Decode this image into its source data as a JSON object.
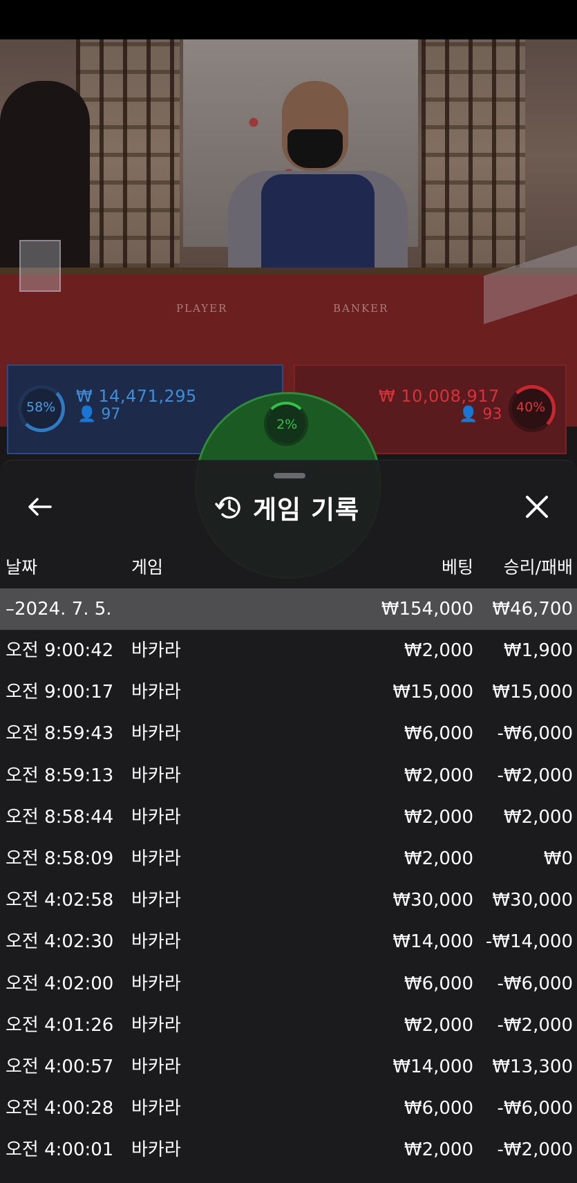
{
  "bet_panel": {
    "player": {
      "percent": "58%",
      "amount": "₩ 14,471,295",
      "players": "97",
      "pct_value": 0.58
    },
    "banker": {
      "percent": "40%",
      "amount": "₩ 10,008,917",
      "players": "93",
      "pct_value": 0.4
    },
    "tie": {
      "percent": "2%",
      "pct_value": 0.02
    }
  },
  "table_labels": {
    "player": "PLAYER",
    "banker": "BANKER"
  },
  "sheet": {
    "title": "게임 기록",
    "icons": {
      "back": "arrow-left-icon",
      "history": "history-icon",
      "close": "close-icon"
    },
    "columns": {
      "date": "날짜",
      "game": "게임",
      "bet": "베팅",
      "result": "승리/패배"
    },
    "summary": {
      "date": "–2024. 7. 5.",
      "bet": "₩154,000",
      "result": "₩46,700"
    },
    "rows": [
      {
        "time": "오전 9:00:42",
        "game": "바카라",
        "bet": "₩2,000",
        "result": "₩1,900"
      },
      {
        "time": "오전 9:00:17",
        "game": "바카라",
        "bet": "₩15,000",
        "result": "₩15,000"
      },
      {
        "time": "오전 8:59:43",
        "game": "바카라",
        "bet": "₩6,000",
        "result": "-₩6,000"
      },
      {
        "time": "오전 8:59:13",
        "game": "바카라",
        "bet": "₩2,000",
        "result": "-₩2,000"
      },
      {
        "time": "오전 8:58:44",
        "game": "바카라",
        "bet": "₩2,000",
        "result": "₩2,000"
      },
      {
        "time": "오전 8:58:09",
        "game": "바카라",
        "bet": "₩2,000",
        "result": "₩0"
      },
      {
        "time": "오전 4:02:58",
        "game": "바카라",
        "bet": "₩30,000",
        "result": "₩30,000"
      },
      {
        "time": "오전 4:02:30",
        "game": "바카라",
        "bet": "₩14,000",
        "result": "-₩14,000"
      },
      {
        "time": "오전 4:02:00",
        "game": "바카라",
        "bet": "₩6,000",
        "result": "-₩6,000"
      },
      {
        "time": "오전 4:01:26",
        "game": "바카라",
        "bet": "₩2,000",
        "result": "-₩2,000"
      },
      {
        "time": "오전 4:00:57",
        "game": "바카라",
        "bet": "₩14,000",
        "result": "₩13,300"
      },
      {
        "time": "오전 4:00:28",
        "game": "바카라",
        "bet": "₩6,000",
        "result": "-₩6,000"
      },
      {
        "time": "오전 4:00:01",
        "game": "바카라",
        "bet": "₩2,000",
        "result": "-₩2,000"
      }
    ]
  },
  "colors": {
    "player_blue": "#2e7bc4",
    "banker_red": "#c8272e",
    "tie_green": "#34c049"
  }
}
